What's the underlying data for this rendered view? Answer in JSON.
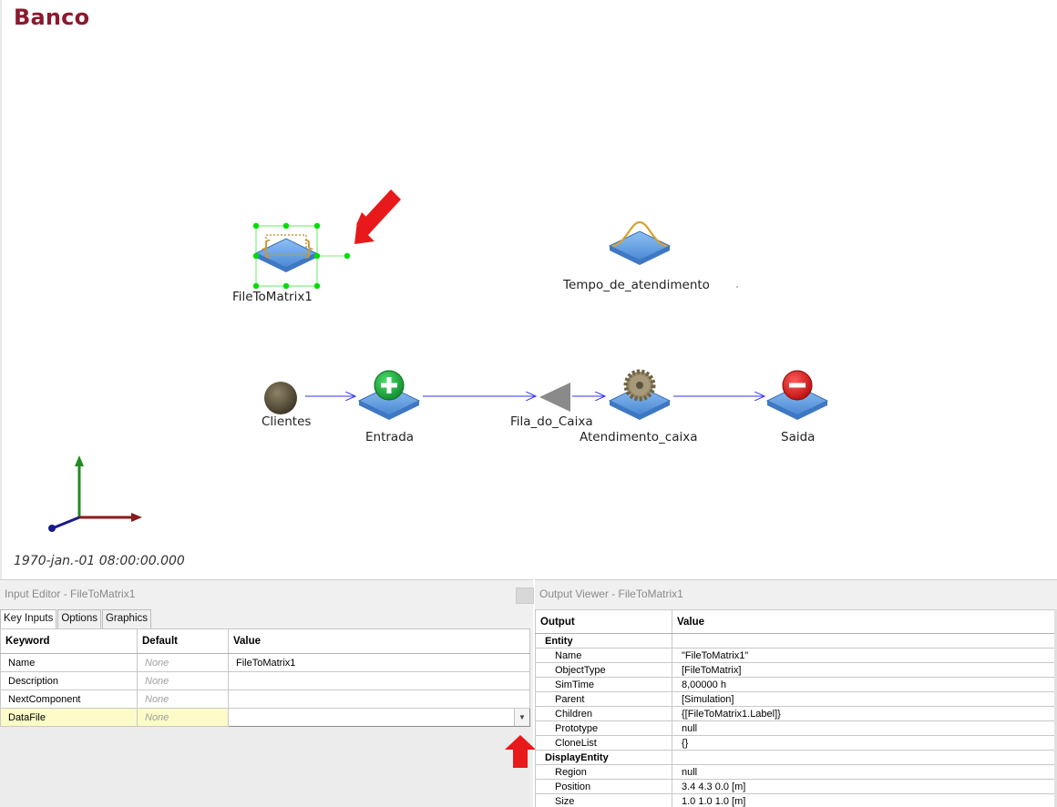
{
  "view": {
    "title": "Banco",
    "clock": "1970-jan.-01 08:00:00.000",
    "entities": [
      {
        "label": "FileToMatrix1",
        "icon": "file-to-matrix-icon"
      },
      {
        "label": "Tempo_de_atendimento",
        "icon": "distribution-icon"
      },
      {
        "label": "Clientes",
        "icon": "entity-sphere-icon"
      },
      {
        "label": "Entrada",
        "icon": "entity-generator-icon"
      },
      {
        "label": "Fila_do_Caixa",
        "icon": "queue-icon"
      },
      {
        "label": "Atendimento_caixa",
        "icon": "server-gear-icon"
      },
      {
        "label": "Saida",
        "icon": "entity-sink-icon"
      }
    ],
    "colors": {
      "title": "#8b1a2e",
      "arrow": "#3333ff",
      "pointer": "#e8191a",
      "selection": "#00dd00",
      "pad": "#5b9be0"
    }
  },
  "input_editor": {
    "title": "Input Editor - FileToMatrix1",
    "tabs": [
      "Key Inputs",
      "Options",
      "Graphics"
    ],
    "columns": [
      "Keyword",
      "Default",
      "Value"
    ],
    "rows": [
      {
        "keyword": "Name",
        "default": "None",
        "value": "FileToMatrix1"
      },
      {
        "keyword": "Description",
        "default": "None",
        "value": ""
      },
      {
        "keyword": "NextComponent",
        "default": "None",
        "value": ""
      },
      {
        "keyword": "DataFile",
        "default": "None",
        "value": ""
      }
    ],
    "selected_row": "DataFile"
  },
  "output_viewer": {
    "title": "Output Viewer - FileToMatrix1",
    "columns": [
      "Output",
      "Value"
    ],
    "groups": [
      {
        "name": "Entity",
        "rows": [
          {
            "key": "Name",
            "value": "\"FileToMatrix1\""
          },
          {
            "key": "ObjectType",
            "value": "[FileToMatrix]"
          },
          {
            "key": "SimTime",
            "value": "8,00000  h"
          },
          {
            "key": "Parent",
            "value": "[Simulation]"
          },
          {
            "key": "Children",
            "value": "{[FileToMatrix1.Label]}"
          },
          {
            "key": "Prototype",
            "value": "null"
          },
          {
            "key": "CloneList",
            "value": "{}"
          }
        ]
      },
      {
        "name": "DisplayEntity",
        "rows": [
          {
            "key": "Region",
            "value": "null"
          },
          {
            "key": "Position",
            "value": "3.4  4.3  0.0  [m]"
          },
          {
            "key": "Size",
            "value": "1.0  1.0  1.0  [m]"
          }
        ]
      }
    ]
  }
}
